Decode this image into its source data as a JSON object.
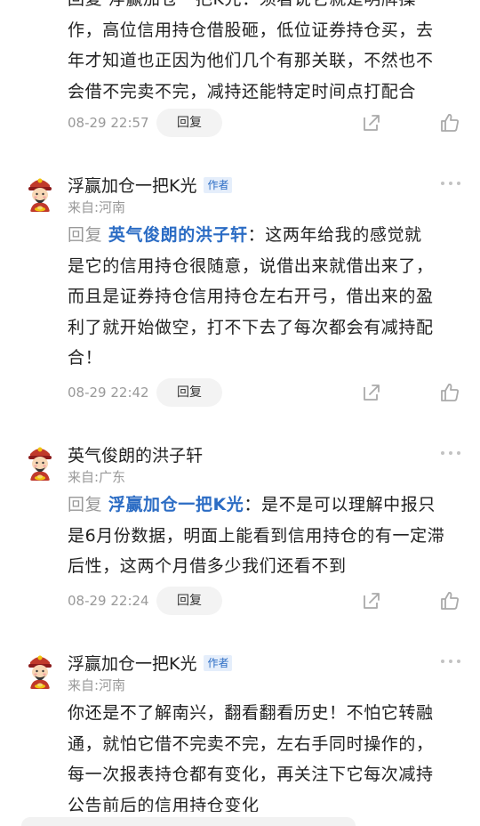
{
  "comments": [
    {
      "partial_top_text_line1": "回复 浮赢加仓一把K光：须看说它就是明牌操",
      "body_lines": [
        "作，高位信用持仓借股砸，低位证券持仓买，去",
        "年才知道也正因为他们几个有那关联，不然也不",
        "会借不完卖不完，减持还能特定时间点打配合"
      ],
      "time": "08-29 22:57",
      "reply_label": "回复"
    },
    {
      "username": "浮赢加仓一把K光",
      "badge": "作者",
      "location": "来自:河南",
      "reply_prefix": "回复",
      "reply_target": "英气俊朗的洪子轩",
      "body_lines": [
        "：这两年给我的感觉就",
        "是它的信用持仓很随意，说借出来就借出来了，",
        "而且是证券持仓信用持仓左右开弓，借出来的盈",
        "利了就开始做空，打不下去了每次都会有减持配",
        "合！"
      ],
      "time": "08-29 22:42",
      "reply_label": "回复"
    },
    {
      "username": "英气俊朗的洪子轩",
      "location": "来自:广东",
      "reply_prefix": "回复",
      "reply_target": "浮赢加仓一把K光",
      "body_lines": [
        "：是不是可以理解中报只",
        "是6月份数据，明面上能看到信用持仓的有一定滞",
        "后性，这两个月借多少我们还看不到"
      ],
      "time": "08-29 22:24",
      "reply_label": "回复"
    },
    {
      "username": "浮赢加仓一把K光",
      "badge": "作者",
      "location": "来自:河南",
      "body_lines": [
        "你还是不了解南兴，翻看翻看历史！不怕它转融",
        "通，就怕它借不完卖不完，左右手同时操作的，",
        "每一次报表持仓都有变化，再关注下它每次减持",
        "公告前后的信用持仓变化"
      ]
    }
  ],
  "colors": {
    "link": "#2b6cc4",
    "muted": "#999999",
    "text": "#222222",
    "badge_bg": "#e5eefb"
  }
}
